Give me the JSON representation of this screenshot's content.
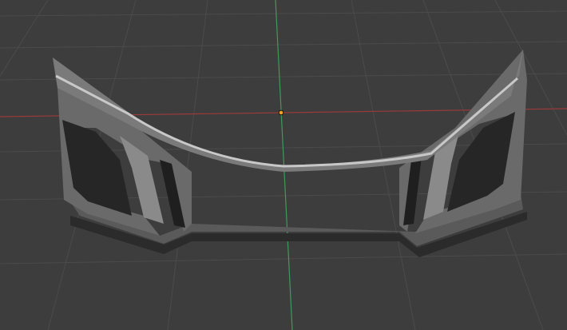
{
  "viewport": {
    "mode": "3d-viewport",
    "background_color": "#3d3d3d",
    "grid_color": "#4b4b4b",
    "x_axis_color": "#9a3a3a",
    "y_axis_color": "#3f9a5a",
    "origin_color": "#f0a020"
  },
  "object": {
    "name_icon": "bumper-mesh",
    "shade_light": "#9a9a9a",
    "shade_mid": "#5e5e5e",
    "shade_dark": "#2a2a2a",
    "rim_color": "#c8c8c8"
  }
}
